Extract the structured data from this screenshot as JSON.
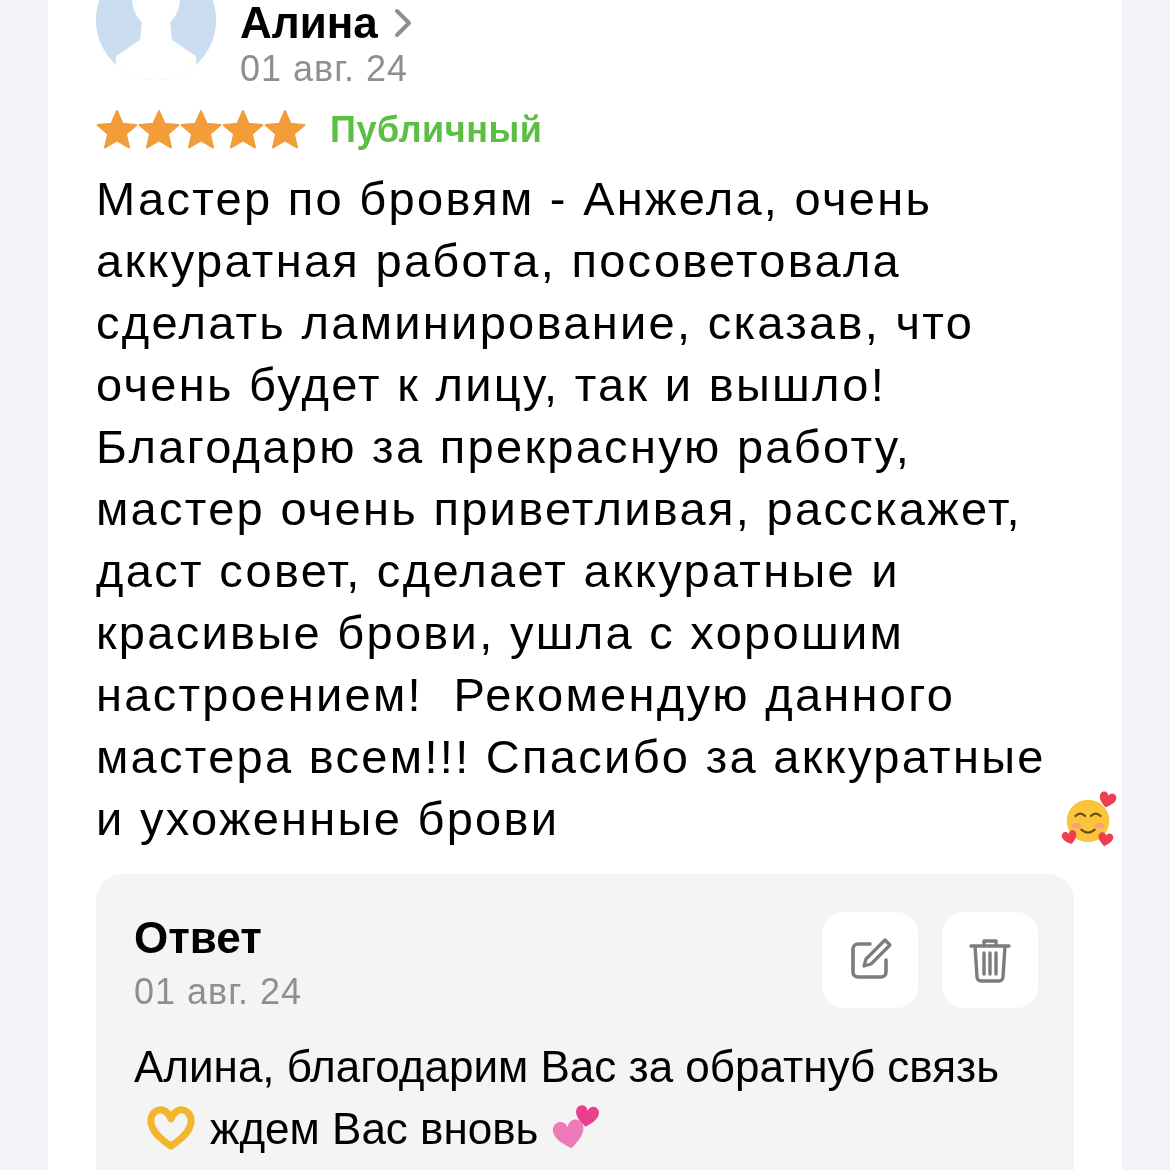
{
  "review": {
    "author": "Алина",
    "date": "01 авг. 24",
    "stars": 5,
    "visibility": "Публичный",
    "body": [
      {
        "kind": "text",
        "text": "Мастер по бровям - Анжела, очень аккуратная работа, посоветовала сделать ламинирование, сказав, что очень будет к лицу, так и вышло! Благодарю за прекрасную работу, мастер очень приветливая, расскажет, даст совет, сделает аккуратные и красивые брови, ушла с хорошим настроением!  Рекомендую данного мастера всем!!! Спасибо за аккуратные и ухоженные брови"
      },
      {
        "kind": "smiley"
      }
    ]
  },
  "reply": {
    "title": "Ответ",
    "date": "01 авг. 24",
    "body": [
      {
        "kind": "text",
        "text": "Алина, благодарим Вас за обратнуб связь"
      },
      {
        "kind": "hands"
      },
      {
        "kind": "text",
        "text": "ждем Вас вновь"
      },
      {
        "kind": "hearts"
      }
    ]
  }
}
